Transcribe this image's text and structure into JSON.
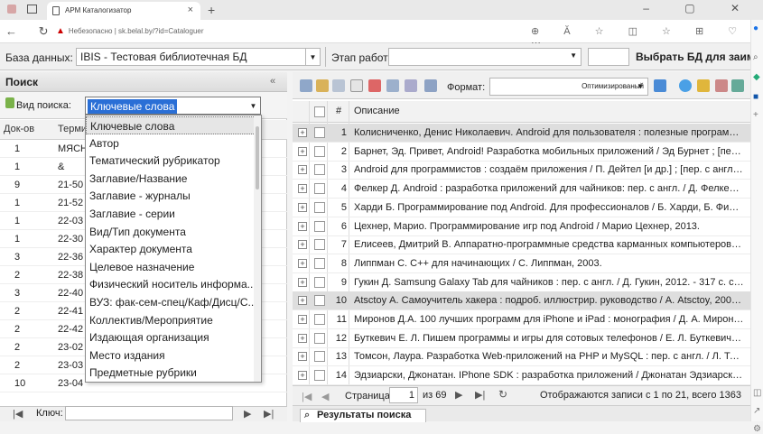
{
  "browser": {
    "tab_title": "АРМ Каталогизатор",
    "url_warning": "Небезопасно",
    "url": "sk.belal.by/?id=Cataloguer",
    "reader_label": "Ă"
  },
  "toolbar": {
    "db_label": "База данных:",
    "db_value": "IBIS - Тестовая библиотечная БД",
    "stage_label": "Этап работы:",
    "stage_value": "",
    "choose_db_label": "Выбрать БД для заим"
  },
  "left": {
    "title": "Поиск",
    "search_type_label": "Вид поиска:",
    "search_type_value": "Ключевые слова",
    "columns": [
      "Док-ов",
      "Терми"
    ],
    "rows": [
      {
        "count": "1",
        "term": "МЯСН"
      },
      {
        "count": "1",
        "term": "&"
      },
      {
        "count": "9",
        "term": "21-50"
      },
      {
        "count": "1",
        "term": "21-52"
      },
      {
        "count": "1",
        "term": "22-03"
      },
      {
        "count": "1",
        "term": "22-30"
      },
      {
        "count": "3",
        "term": "22-36"
      },
      {
        "count": "2",
        "term": "22-38"
      },
      {
        "count": "3",
        "term": "22-40"
      },
      {
        "count": "2",
        "term": "22-41"
      },
      {
        "count": "2",
        "term": "22-42"
      },
      {
        "count": "2",
        "term": "23-02"
      },
      {
        "count": "2",
        "term": "23-03"
      },
      {
        "count": "10",
        "term": "23-04"
      }
    ],
    "key_label": "Ключ:",
    "dropdown_options": [
      "Ключевые слова",
      "Автор",
      "Тематический рубрикатор",
      "Заглавие/Название",
      "Заглавие - журналы",
      "Заглавие - серии",
      "Вид/Тип документа",
      "Характер документа",
      "Целевое назначение",
      "Физический носитель информа...",
      "ВУЗ: фак-сем-спец/Каф/Дисц/С...",
      "Коллектив/Мероприятие",
      "Издающая организация",
      "Место издания",
      "Предметные рубрики"
    ]
  },
  "right": {
    "format_label": "Формат:",
    "format_value": "Оптимизированый",
    "col_num": "#",
    "col_desc": "Описание",
    "rows": [
      {
        "n": "1",
        "d": "Колисниченко, Денис Николаевич. Android для пользователя : полезные программ..."
      },
      {
        "n": "2",
        "d": "Барнет, Эд. Привет, Android! Разработка мобильных приложений / Эд Бурнет ; [пер. ..."
      },
      {
        "n": "3",
        "d": "Android для программистов : создаём приложения / П. Дейтел [и др.] ; [пер. с англ. ..."
      },
      {
        "n": "4",
        "d": "Фелкер Д. Android : разработка приложений для чайников: пер. с англ. / Д. Фелкер, ..."
      },
      {
        "n": "5",
        "d": "Харди Б. Программирование под Android. Для профессионалов / Б. Харди, Б. Филл..."
      },
      {
        "n": "6",
        "d": "Цехнер, Марио. Программирование игр под Android / Марио Цехнер, 2013."
      },
      {
        "n": "7",
        "d": "Елисеев, Дмитрий В. Аппаратно-программные средства карманных компьютеров / ..."
      },
      {
        "n": "8",
        "d": "Липпман С. С++ для начинающих / С. Липпман, 2003."
      },
      {
        "n": "9",
        "d": "Гукин Д. Samsung Galaxy Tab для чайников : пер. с англ. / Д. Гукин, 2012. - 317 с. с. ..."
      },
      {
        "n": "10",
        "d": "Atsctoy А. Самоучитель хакера : подроб. иллюстрир. руководство / А. Atsctoy, 2005. ..."
      },
      {
        "n": "11",
        "d": "Миронов Д.А. 100 лучших программ для iPhone и iPad : монография / Д. А. Мироно..."
      },
      {
        "n": "12",
        "d": "Буткевич Е. Л. Пишем программы и игры для сотовых телефонов / Е. Л. Буткевич, ..."
      },
      {
        "n": "13",
        "d": "Томсон, Лаура. Разработка Web-приложений на PHP и MySQL : пер. с англ. / Л. Том..."
      },
      {
        "n": "14",
        "d": "Эдзиарски, Джонатан. IPhone SDK : разработка приложений / Джонатан Эдзиарски ;..."
      }
    ],
    "page_label": "Страница",
    "page_value": "1",
    "page_of": "из 69",
    "records_info": "Отображаются записи с 1 по 21, всего 1363",
    "results_tab": "Результаты поиска"
  }
}
